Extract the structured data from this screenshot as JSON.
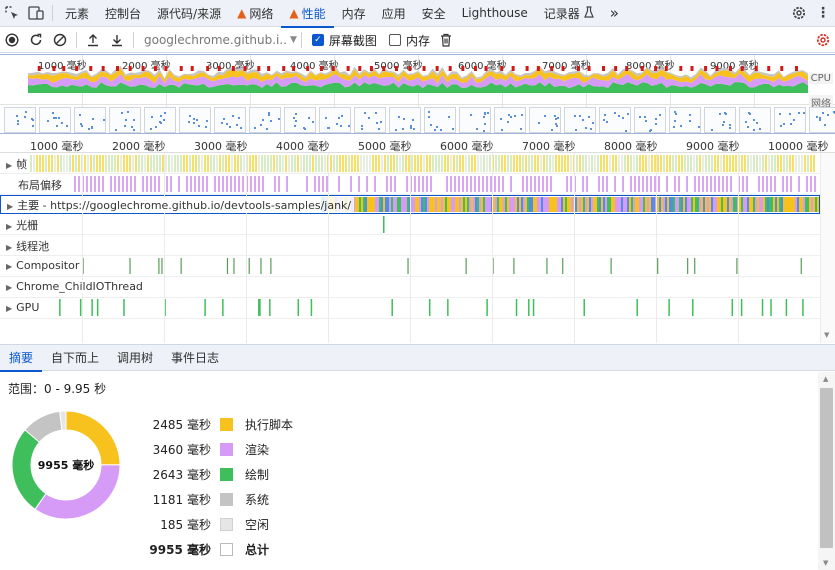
{
  "tabs": {
    "elements": "元素",
    "console": "控制台",
    "sources": "源代码/来源",
    "network": "网络",
    "performance": "性能",
    "memory": "内存",
    "application": "应用",
    "security": "安全",
    "lighthouse": "Lighthouse",
    "recorder": "记录器",
    "more": "»"
  },
  "toolbar": {
    "url": "googlechrome.github.i...",
    "screenshots_label": "屏幕截图",
    "screenshots_checked": true,
    "memory_label": "内存",
    "memory_checked": false
  },
  "overview": {
    "ticks": [
      "1000 毫秒",
      "2000 毫秒",
      "3000 毫秒",
      "4000 毫秒",
      "5000 毫秒",
      "6000 毫秒",
      "7000 毫秒",
      "8000 毫秒",
      "9000 毫秒"
    ],
    "cpu_label": "CPU",
    "net_label": "网络"
  },
  "ruler": {
    "ticks": [
      "1000 毫秒",
      "2000 毫秒",
      "3000 毫秒",
      "4000 毫秒",
      "5000 毫秒",
      "6000 毫秒",
      "7000 毫秒",
      "8000 毫秒",
      "9000 毫秒",
      "10000 毫秒"
    ]
  },
  "tracks": {
    "frames": "帧",
    "layout_shifts": "布局偏移",
    "main": "主要 - https://googlechrome.github.io/devtools-samples/jank/",
    "raster": "光栅",
    "thread_pool": "线程池",
    "compositor": "Compositor",
    "io_thread": "Chrome_ChildIOThread",
    "gpu": "GPU"
  },
  "bottom_tabs": {
    "summary": "摘要",
    "bottom_up": "自下而上",
    "call_tree": "调用树",
    "event_log": "事件日志"
  },
  "summary": {
    "range": "范围：0 - 9.95 秒",
    "total_center": "9955 毫秒",
    "items": [
      {
        "value": "2485 毫秒",
        "name": "执行脚本",
        "color": "#f8c21e",
        "ms": 2485
      },
      {
        "value": "3460 毫秒",
        "name": "渲染",
        "color": "#d59bf7",
        "ms": 3460
      },
      {
        "value": "2643 毫秒",
        "name": "绘制",
        "color": "#3fbf5c",
        "ms": 2643
      },
      {
        "value": "1181 毫秒",
        "name": "系统",
        "color": "#c4c4c4",
        "ms": 1181
      },
      {
        "value": "185 毫秒",
        "name": "空闲",
        "color": "#e6e6e6",
        "ms": 185
      }
    ],
    "total_value": "9955 毫秒",
    "total_name": "总计"
  }
}
